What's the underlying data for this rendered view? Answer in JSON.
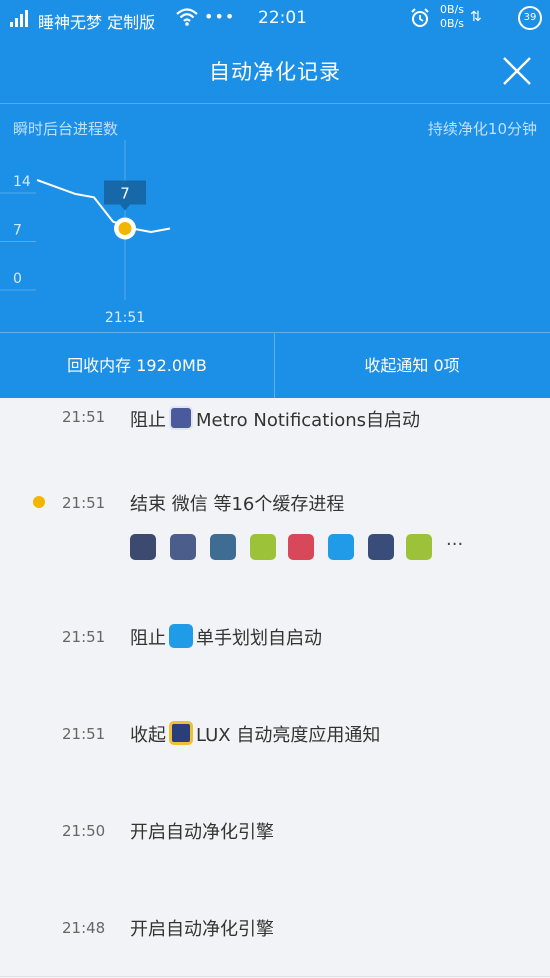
{
  "status_bar": {
    "carrier": "睡神无梦 定制版",
    "more": "•••",
    "time": "22:01",
    "net_up": "0B/s",
    "net_down": "0B/s",
    "battery": "39"
  },
  "header": {
    "title": "自动净化记录"
  },
  "chart_header": {
    "left_label": "瞬时后台进程数",
    "right_label": "持续净化10分钟"
  },
  "chart_data": {
    "type": "line",
    "y_ticks": [
      "14",
      "7",
      "0"
    ],
    "ylim": [
      0,
      14
    ],
    "x_ticks": [
      "21:51"
    ],
    "values": [
      14,
      13,
      12,
      11.5,
      8,
      7,
      6.5,
      7
    ],
    "highlight": {
      "value": "7"
    }
  },
  "stats": {
    "memory": "回收内存 192.0MB",
    "notifications": "收起通知 0项"
  },
  "colors": {
    "primary": "#1c8fe6",
    "highlight_dot": "#f2b600"
  },
  "records": [
    {
      "time": "21:51",
      "text_before": "阻止",
      "text_after": "Metro Notifications自启动",
      "icon": "metro-notifications-icon"
    },
    {
      "time": "21:51",
      "text": "结束 微信 等16个缓存进程",
      "highlighted": true,
      "icons": [
        "wechat-icon",
        "contact-card-icon",
        "shield-app-icon",
        "android-icon",
        "contacts-icon",
        "browser-icon",
        "owl-app-icon",
        "android-icon"
      ],
      "more": "···"
    },
    {
      "time": "21:51",
      "text_before": "阻止",
      "text_after": "单手划划自启动",
      "icon": "swipe-app-icon"
    },
    {
      "time": "21:51",
      "text_before": "收起",
      "text_after": "LUX 自动亮度应用通知",
      "icon": "lux-icon"
    },
    {
      "time": "21:50",
      "text": "开启自动净化引擎"
    },
    {
      "time": "21:48",
      "text": "开启自动净化引擎"
    }
  ]
}
